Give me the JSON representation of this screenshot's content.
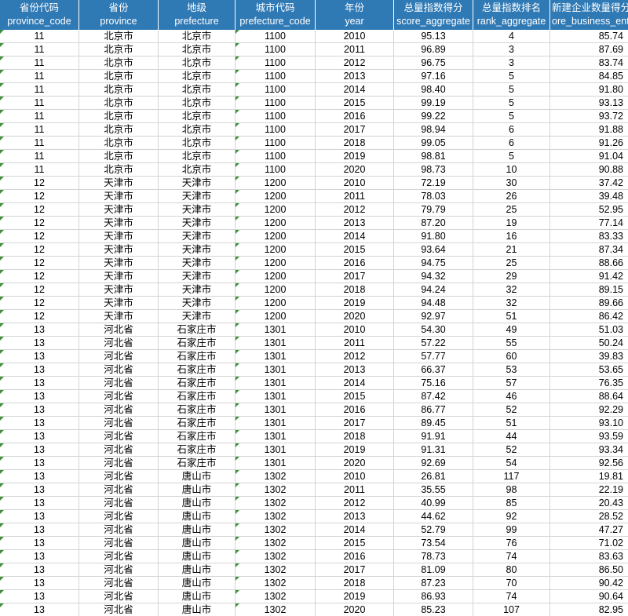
{
  "columns": [
    {
      "zh": "省份代码",
      "en": "province_code"
    },
    {
      "zh": "省份",
      "en": "province"
    },
    {
      "zh": "地级",
      "en": "prefecture"
    },
    {
      "zh": "城市代码",
      "en": "prefecture_code"
    },
    {
      "zh": "年份",
      "en": "year"
    },
    {
      "zh": "总量指数得分",
      "en": "score_aggregate"
    },
    {
      "zh": "总量指数排名",
      "en": "rank_aggregate"
    },
    {
      "zh": "新建企业数量得分",
      "en": "ore_business_ent"
    }
  ],
  "colors": {
    "header_bg": "#2f79b5",
    "header_text": "#ffffff",
    "grid": "#d4d4d4",
    "text_marker": "#3f8f3f"
  },
  "rows": [
    [
      "11",
      "北京市",
      "北京市",
      "1100",
      "2010",
      "95.13",
      "4",
      "85.74"
    ],
    [
      "11",
      "北京市",
      "北京市",
      "1100",
      "2011",
      "96.89",
      "3",
      "87.69"
    ],
    [
      "11",
      "北京市",
      "北京市",
      "1100",
      "2012",
      "96.75",
      "3",
      "83.74"
    ],
    [
      "11",
      "北京市",
      "北京市",
      "1100",
      "2013",
      "97.16",
      "5",
      "84.85"
    ],
    [
      "11",
      "北京市",
      "北京市",
      "1100",
      "2014",
      "98.40",
      "5",
      "91.80"
    ],
    [
      "11",
      "北京市",
      "北京市",
      "1100",
      "2015",
      "99.19",
      "5",
      "93.13"
    ],
    [
      "11",
      "北京市",
      "北京市",
      "1100",
      "2016",
      "99.22",
      "5",
      "93.72"
    ],
    [
      "11",
      "北京市",
      "北京市",
      "1100",
      "2017",
      "98.94",
      "6",
      "91.88"
    ],
    [
      "11",
      "北京市",
      "北京市",
      "1100",
      "2018",
      "99.05",
      "6",
      "91.26"
    ],
    [
      "11",
      "北京市",
      "北京市",
      "1100",
      "2019",
      "98.81",
      "5",
      "91.04"
    ],
    [
      "11",
      "北京市",
      "北京市",
      "1100",
      "2020",
      "98.73",
      "10",
      "90.88"
    ],
    [
      "12",
      "天津市",
      "天津市",
      "1200",
      "2010",
      "72.19",
      "30",
      "37.42"
    ],
    [
      "12",
      "天津市",
      "天津市",
      "1200",
      "2011",
      "78.03",
      "26",
      "39.48"
    ],
    [
      "12",
      "天津市",
      "天津市",
      "1200",
      "2012",
      "79.79",
      "25",
      "52.95"
    ],
    [
      "12",
      "天津市",
      "天津市",
      "1200",
      "2013",
      "87.20",
      "19",
      "77.14"
    ],
    [
      "12",
      "天津市",
      "天津市",
      "1200",
      "2014",
      "91.80",
      "16",
      "83.33"
    ],
    [
      "12",
      "天津市",
      "天津市",
      "1200",
      "2015",
      "93.64",
      "21",
      "87.34"
    ],
    [
      "12",
      "天津市",
      "天津市",
      "1200",
      "2016",
      "94.75",
      "25",
      "88.66"
    ],
    [
      "12",
      "天津市",
      "天津市",
      "1200",
      "2017",
      "94.32",
      "29",
      "91.42"
    ],
    [
      "12",
      "天津市",
      "天津市",
      "1200",
      "2018",
      "94.24",
      "32",
      "89.15"
    ],
    [
      "12",
      "天津市",
      "天津市",
      "1200",
      "2019",
      "94.48",
      "32",
      "89.66"
    ],
    [
      "12",
      "天津市",
      "天津市",
      "1200",
      "2020",
      "92.97",
      "51",
      "86.42"
    ],
    [
      "13",
      "河北省",
      "石家庄市",
      "1301",
      "2010",
      "54.30",
      "49",
      "51.03"
    ],
    [
      "13",
      "河北省",
      "石家庄市",
      "1301",
      "2011",
      "57.22",
      "55",
      "50.24"
    ],
    [
      "13",
      "河北省",
      "石家庄市",
      "1301",
      "2012",
      "57.77",
      "60",
      "39.83"
    ],
    [
      "13",
      "河北省",
      "石家庄市",
      "1301",
      "2013",
      "66.37",
      "53",
      "53.65"
    ],
    [
      "13",
      "河北省",
      "石家庄市",
      "1301",
      "2014",
      "75.16",
      "57",
      "76.35"
    ],
    [
      "13",
      "河北省",
      "石家庄市",
      "1301",
      "2015",
      "87.42",
      "46",
      "88.64"
    ],
    [
      "13",
      "河北省",
      "石家庄市",
      "1301",
      "2016",
      "86.77",
      "52",
      "92.29"
    ],
    [
      "13",
      "河北省",
      "石家庄市",
      "1301",
      "2017",
      "89.45",
      "51",
      "93.10"
    ],
    [
      "13",
      "河北省",
      "石家庄市",
      "1301",
      "2018",
      "91.91",
      "44",
      "93.59"
    ],
    [
      "13",
      "河北省",
      "石家庄市",
      "1301",
      "2019",
      "91.31",
      "52",
      "93.34"
    ],
    [
      "13",
      "河北省",
      "石家庄市",
      "1301",
      "2020",
      "92.69",
      "54",
      "92.56"
    ],
    [
      "13",
      "河北省",
      "唐山市",
      "1302",
      "2010",
      "26.81",
      "117",
      "19.81"
    ],
    [
      "13",
      "河北省",
      "唐山市",
      "1302",
      "2011",
      "35.55",
      "98",
      "22.19"
    ],
    [
      "13",
      "河北省",
      "唐山市",
      "1302",
      "2012",
      "40.99",
      "85",
      "20.43"
    ],
    [
      "13",
      "河北省",
      "唐山市",
      "1302",
      "2013",
      "44.62",
      "92",
      "28.52"
    ],
    [
      "13",
      "河北省",
      "唐山市",
      "1302",
      "2014",
      "52.79",
      "99",
      "47.27"
    ],
    [
      "13",
      "河北省",
      "唐山市",
      "1302",
      "2015",
      "73.54",
      "76",
      "71.02"
    ],
    [
      "13",
      "河北省",
      "唐山市",
      "1302",
      "2016",
      "78.73",
      "74",
      "83.63"
    ],
    [
      "13",
      "河北省",
      "唐山市",
      "1302",
      "2017",
      "81.09",
      "80",
      "86.50"
    ],
    [
      "13",
      "河北省",
      "唐山市",
      "1302",
      "2018",
      "87.23",
      "70",
      "90.42"
    ],
    [
      "13",
      "河北省",
      "唐山市",
      "1302",
      "2019",
      "86.93",
      "74",
      "90.64"
    ],
    [
      "13",
      "河北省",
      "唐山市",
      "1302",
      "2020",
      "85.23",
      "107",
      "82.95"
    ]
  ]
}
